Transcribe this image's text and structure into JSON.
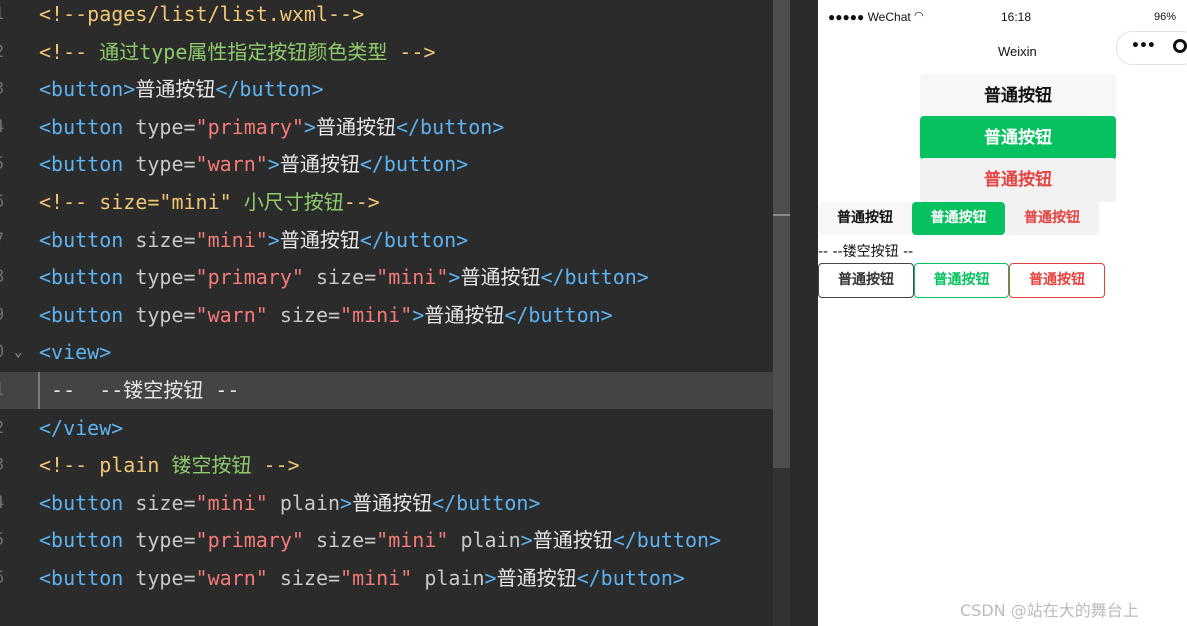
{
  "editor": {
    "lines": [
      {
        "num": "1",
        "tokens": [
          {
            "cls": "t-cmt",
            "text": "<!--pages/list/list.wxml-->"
          }
        ]
      },
      {
        "num": "2",
        "tokens": [
          {
            "cls": "t-cmt",
            "text": "<!-- "
          },
          {
            "cls": "t-cmt-cn",
            "text": "通过type属性指定按钮颜色类型"
          },
          {
            "cls": "t-cmt",
            "text": " -->"
          }
        ]
      },
      {
        "num": "3",
        "tokens": [
          {
            "cls": "t-tag",
            "text": "<button>"
          },
          {
            "cls": "t-text",
            "text": "普通按钮"
          },
          {
            "cls": "t-tag",
            "text": "</button>"
          }
        ]
      },
      {
        "num": "4",
        "tokens": [
          {
            "cls": "t-tag",
            "text": "<button"
          },
          {
            "cls": "t-attr",
            "text": " type="
          },
          {
            "cls": "t-val",
            "text": "\"primary\""
          },
          {
            "cls": "t-tag",
            "text": ">"
          },
          {
            "cls": "t-text",
            "text": "普通按钮"
          },
          {
            "cls": "t-tag",
            "text": "</button>"
          }
        ]
      },
      {
        "num": "5",
        "tokens": [
          {
            "cls": "t-tag",
            "text": "<button"
          },
          {
            "cls": "t-attr",
            "text": " type="
          },
          {
            "cls": "t-val",
            "text": "\"warn\""
          },
          {
            "cls": "t-tag",
            "text": ">"
          },
          {
            "cls": "t-text",
            "text": "普通按钮"
          },
          {
            "cls": "t-tag",
            "text": "</button>"
          }
        ]
      },
      {
        "num": "6",
        "tokens": [
          {
            "cls": "t-cmt",
            "text": "<!-- size=\"mini\" "
          },
          {
            "cls": "t-cmt-cn",
            "text": "小尺寸按钮"
          },
          {
            "cls": "t-cmt",
            "text": "-->"
          }
        ]
      },
      {
        "num": "7",
        "tokens": [
          {
            "cls": "t-tag",
            "text": "<button"
          },
          {
            "cls": "t-attr",
            "text": " size="
          },
          {
            "cls": "t-val",
            "text": "\"mini\""
          },
          {
            "cls": "t-tag",
            "text": ">"
          },
          {
            "cls": "t-text",
            "text": "普通按钮"
          },
          {
            "cls": "t-tag",
            "text": "</button>"
          }
        ]
      },
      {
        "num": "8",
        "tokens": [
          {
            "cls": "t-tag",
            "text": "<button"
          },
          {
            "cls": "t-attr",
            "text": " type="
          },
          {
            "cls": "t-val",
            "text": "\"primary\""
          },
          {
            "cls": "t-attr",
            "text": " size="
          },
          {
            "cls": "t-val",
            "text": "\"mini\""
          },
          {
            "cls": "t-tag",
            "text": ">"
          },
          {
            "cls": "t-text",
            "text": "普通按钮"
          },
          {
            "cls": "t-tag",
            "text": "</button>"
          }
        ]
      },
      {
        "num": "9",
        "tokens": [
          {
            "cls": "t-tag",
            "text": "<button"
          },
          {
            "cls": "t-attr",
            "text": " type="
          },
          {
            "cls": "t-val",
            "text": "\"warn\""
          },
          {
            "cls": "t-attr",
            "text": " size="
          },
          {
            "cls": "t-val",
            "text": "\"mini\""
          },
          {
            "cls": "t-tag",
            "text": ">"
          },
          {
            "cls": "t-text",
            "text": "普通按钮"
          },
          {
            "cls": "t-tag",
            "text": "</button>"
          }
        ]
      },
      {
        "num": "0",
        "fold": true,
        "tokens": [
          {
            "cls": "t-tag",
            "text": "<view>"
          }
        ]
      },
      {
        "num": "1",
        "current": true,
        "tokens": [
          {
            "cls": "t-text",
            "text": " --  --镂空按钮 --"
          }
        ]
      },
      {
        "num": "2",
        "tokens": [
          {
            "cls": "t-tag",
            "text": "</view>"
          }
        ]
      },
      {
        "num": "3",
        "tokens": [
          {
            "cls": "t-cmt",
            "text": "<!-- plain "
          },
          {
            "cls": "t-cmt-cn",
            "text": "镂空按钮"
          },
          {
            "cls": "t-cmt",
            "text": " -->"
          }
        ]
      },
      {
        "num": "4",
        "tokens": [
          {
            "cls": "t-tag",
            "text": "<button"
          },
          {
            "cls": "t-attr",
            "text": " size="
          },
          {
            "cls": "t-val",
            "text": "\"mini\""
          },
          {
            "cls": "t-attr",
            "text": " plain"
          },
          {
            "cls": "t-tag",
            "text": ">"
          },
          {
            "cls": "t-text",
            "text": "普通按钮"
          },
          {
            "cls": "t-tag",
            "text": "</button>"
          }
        ]
      },
      {
        "num": "5",
        "tokens": [
          {
            "cls": "t-tag",
            "text": "<button"
          },
          {
            "cls": "t-attr",
            "text": " type="
          },
          {
            "cls": "t-val",
            "text": "\"primary\""
          },
          {
            "cls": "t-attr",
            "text": " size="
          },
          {
            "cls": "t-val",
            "text": "\"mini\""
          },
          {
            "cls": "t-attr",
            "text": " plain"
          },
          {
            "cls": "t-tag",
            "text": ">"
          },
          {
            "cls": "t-text",
            "text": "普通按钮"
          },
          {
            "cls": "t-tag",
            "text": "</button>"
          }
        ]
      },
      {
        "num": "6",
        "tokens": [
          {
            "cls": "t-tag",
            "text": "<button"
          },
          {
            "cls": "t-attr",
            "text": " type="
          },
          {
            "cls": "t-val",
            "text": "\"warn\""
          },
          {
            "cls": "t-attr",
            "text": " size="
          },
          {
            "cls": "t-val",
            "text": "\"mini\""
          },
          {
            "cls": "t-attr",
            "text": " plain"
          },
          {
            "cls": "t-tag",
            "text": ">"
          },
          {
            "cls": "t-text",
            "text": "普通按钮"
          },
          {
            "cls": "t-tag",
            "text": "</button>"
          }
        ]
      }
    ]
  },
  "phone": {
    "status": {
      "signal": "●●●●● WeChat",
      "wifi_icon": "wifi-icon",
      "time": "16:18",
      "battery": "96%"
    },
    "nav": {
      "title": "Weixin",
      "more_icon": "more-dots-icon",
      "close_icon": "capsule-close-icon"
    },
    "buttons": {
      "default": "普通按钮",
      "primary": "普通按钮",
      "warn": "普通按钮",
      "mini_default": "普通按钮",
      "mini_primary": "普通按钮",
      "mini_warn": "普通按钮",
      "plain_line": "-- --镂空按钮 --",
      "plain_default": "普通按钮",
      "plain_primary": "普通按钮",
      "plain_warn": "普通按钮"
    },
    "colors": {
      "primary": "#07c160",
      "warn": "#e64340",
      "default_bg": "#f7f7f7"
    }
  },
  "watermark": "CSDN @站在大的舞台上"
}
